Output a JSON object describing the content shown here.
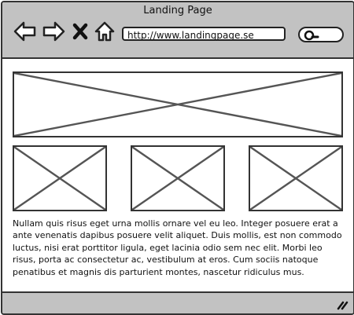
{
  "window": {
    "title": "Landing Page"
  },
  "toolbar": {
    "icons": [
      "back-arrow-icon",
      "forward-arrow-icon",
      "close-x-icon",
      "home-icon",
      "search-icon"
    ],
    "url": "http://www.landingpage.se"
  },
  "main": {
    "hero_placeholder": "image-placeholder",
    "thumbnails": [
      "image-placeholder",
      "image-placeholder",
      "image-placeholder"
    ],
    "paragraph": "Nullam quis risus eget urna mollis ornare vel eu leo. Integer posuere erat a ante venenatis dapibus posuere velit aliquet. Duis mollis, est non commodo luctus, nisi erat porttitor ligula, eget lacinia odio sem nec elit. Morbi leo risus, porta ac consectetur ac, vestibulum at eros. Cum sociis natoque penatibus et magnis dis parturient montes, nascetur ridiculus mus."
  },
  "colors": {
    "chrome": "#c2c2c2",
    "stroke": "#333333",
    "background": "#ffffff"
  }
}
